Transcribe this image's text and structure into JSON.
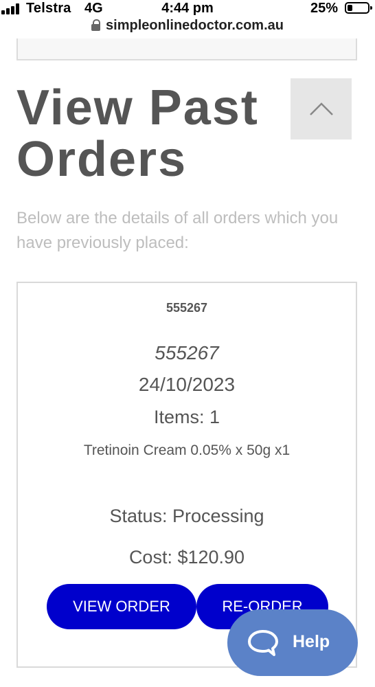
{
  "status_bar": {
    "carrier": "Telstra",
    "network": "4G",
    "time": "4:44 pm",
    "battery": "25%"
  },
  "browser": {
    "url": "simpleonlinedoctor.com.au"
  },
  "page": {
    "title": "View Past Orders",
    "intro": "Below are the details of all orders which you have previously placed:"
  },
  "order": {
    "header_id": "555267",
    "order_id": "555267",
    "date": "24/10/2023",
    "items": "Items: 1",
    "product": "Tretinoin Cream 0.05% x 50g x1",
    "status": "Status: Processing",
    "cost": "Cost: $120.90",
    "view_label": "VIEW ORDER",
    "reorder_label": "RE-ORDER"
  },
  "help": {
    "label": "Help"
  },
  "colors": {
    "primary_button": "#0000cc",
    "help_widget": "#5b82c8",
    "heading": "#555555",
    "muted_text": "#bdbdbd"
  },
  "icons": {
    "lock": "lock-icon",
    "collapse": "chevron-up-icon",
    "help": "chat-bubble-icon"
  }
}
